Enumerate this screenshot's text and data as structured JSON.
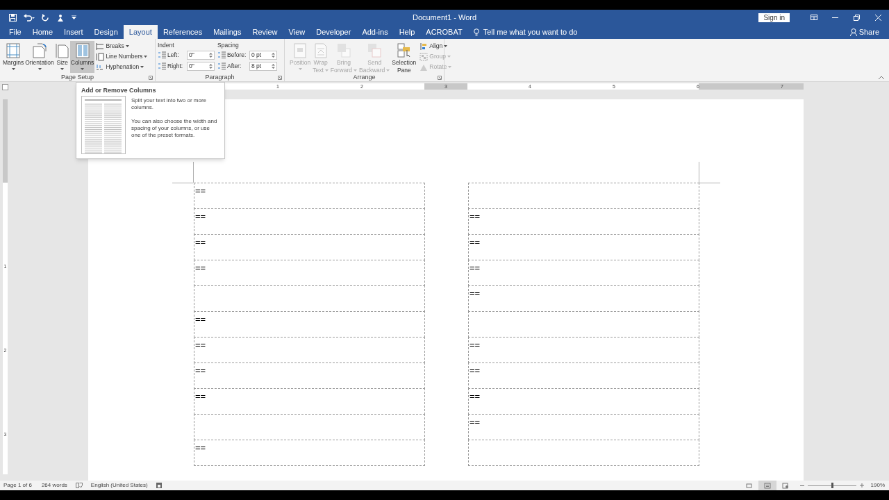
{
  "window": {
    "title": "Document1  -  Word",
    "sign_in": "Sign in",
    "share": "Share"
  },
  "tabs": [
    {
      "label": "File",
      "selected": false
    },
    {
      "label": "Home",
      "selected": false
    },
    {
      "label": "Insert",
      "selected": false
    },
    {
      "label": "Design",
      "selected": false
    },
    {
      "label": "Layout",
      "selected": true
    },
    {
      "label": "References",
      "selected": false
    },
    {
      "label": "Mailings",
      "selected": false
    },
    {
      "label": "Review",
      "selected": false
    },
    {
      "label": "View",
      "selected": false
    },
    {
      "label": "Developer",
      "selected": false
    },
    {
      "label": "Add-ins",
      "selected": false
    },
    {
      "label": "Help",
      "selected": false
    },
    {
      "label": "ACROBAT",
      "selected": false
    }
  ],
  "tell_me": "Tell me what you want to do",
  "page_setup": {
    "title": "Page Setup",
    "large_buttons": [
      {
        "kind": "margins",
        "lines": [
          "Margins"
        ],
        "selected": false
      },
      {
        "kind": "orientation",
        "lines": [
          "Orientation"
        ],
        "selected": false
      },
      {
        "kind": "size",
        "lines": [
          "Size"
        ],
        "selected": false
      },
      {
        "kind": "columns",
        "lines": [
          "Columns"
        ],
        "selected": true
      }
    ],
    "small_buttons": [
      {
        "kind": "breaks",
        "label": "Breaks"
      },
      {
        "kind": "line_numbers",
        "label": "Line Numbers"
      },
      {
        "kind": "hyphenation",
        "label": "Hyphenation"
      }
    ]
  },
  "paragraph": {
    "title": "Paragraph",
    "indent_label": "Indent",
    "spacing_label": "Spacing",
    "indent": [
      {
        "label": "Left:",
        "value": "0\""
      },
      {
        "label": "Right:",
        "value": "0\""
      }
    ],
    "spacing": [
      {
        "label": "Before:",
        "value": "0 pt"
      },
      {
        "label": "After:",
        "value": "8 pt"
      }
    ]
  },
  "arrange": {
    "title": "Arrange",
    "large_buttons": [
      {
        "kind": "position",
        "lines": [
          "Position"
        ],
        "disabled": true
      },
      {
        "kind": "wrap",
        "lines": [
          "Wrap",
          "Text"
        ],
        "disabled": true
      },
      {
        "kind": "forward",
        "lines": [
          "Bring",
          "Forward"
        ],
        "disabled": true
      },
      {
        "kind": "backward",
        "lines": [
          "Send",
          "Backward"
        ],
        "disabled": true
      },
      {
        "kind": "selection",
        "lines": [
          "Selection",
          "Pane"
        ],
        "disabled": false
      }
    ],
    "small_buttons": [
      {
        "kind": "align",
        "label": "Align",
        "disabled": false
      },
      {
        "kind": "group",
        "label": "Group",
        "disabled": true
      },
      {
        "kind": "rotate",
        "label": "Rotate",
        "disabled": true
      }
    ]
  },
  "tooltip": {
    "title": "Add or Remove Columns",
    "paragraphs": [
      "Split your text into two or more columns.",
      "You can also choose the width and spacing of your columns, or use one of the preset formats."
    ]
  },
  "ruler": {
    "labels": [
      "1",
      "2",
      "3",
      "4",
      "5",
      "6",
      "7"
    ],
    "vertical_labels": [
      "1",
      "2",
      "3"
    ]
  },
  "document": {
    "columns": [
      {
        "cells": [
          {
            "kind": "text",
            "text": "=="
          },
          {
            "kind": "text",
            "text": "=="
          },
          {
            "kind": "text",
            "text": "=="
          },
          {
            "kind": "text",
            "text": "=="
          },
          {
            "kind": "blank"
          },
          {
            "kind": "text",
            "text": "=="
          },
          {
            "kind": "text",
            "text": "=="
          },
          {
            "kind": "text",
            "text": "=="
          },
          {
            "kind": "text",
            "text": "=="
          },
          {
            "kind": "blank"
          },
          {
            "kind": "text",
            "text": "=="
          }
        ]
      },
      {
        "cells": [
          {
            "kind": "blank"
          },
          {
            "kind": "text",
            "text": "=="
          },
          {
            "kind": "text",
            "text": "=="
          },
          {
            "kind": "text",
            "text": "=="
          },
          {
            "kind": "text",
            "text": "=="
          },
          {
            "kind": "blank"
          },
          {
            "kind": "text",
            "text": "=="
          },
          {
            "kind": "text",
            "text": "=="
          },
          {
            "kind": "text",
            "text": "=="
          },
          {
            "kind": "text",
            "text": "=="
          },
          {
            "kind": "blank"
          }
        ]
      }
    ]
  },
  "status_bar": {
    "page": "Page 1 of 6",
    "words": "264 words",
    "language": "English (United States)",
    "zoom": "190%",
    "zoom_slider": {
      "level": 0.5
    },
    "views": [
      {
        "kind": "focus",
        "selected": false
      },
      {
        "kind": "print",
        "selected": true
      },
      {
        "kind": "web",
        "selected": false
      }
    ]
  }
}
